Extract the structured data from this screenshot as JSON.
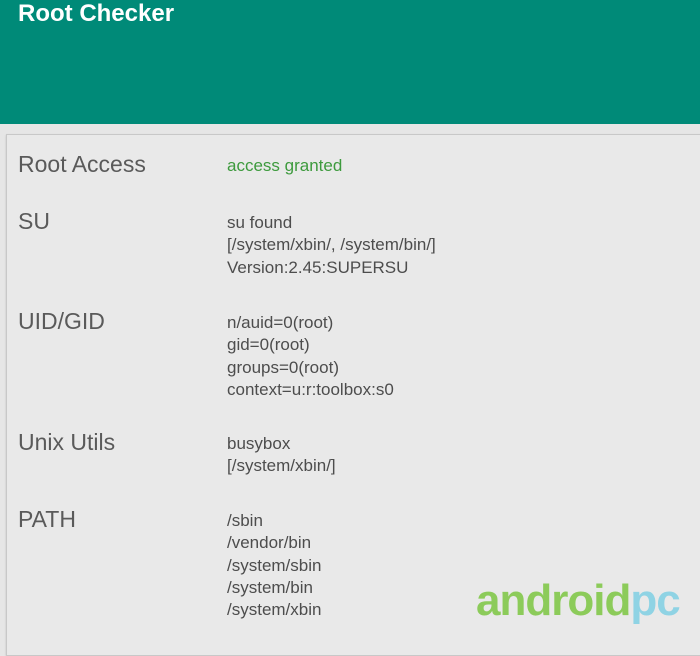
{
  "app": {
    "title": "Root Checker"
  },
  "rows": [
    {
      "label": "Root Access",
      "values": [
        "access granted"
      ]
    },
    {
      "label": "SU",
      "values": [
        "su found",
        "[/system/xbin/, /system/bin/]",
        "Version:2.45:SUPERSU"
      ]
    },
    {
      "label": "UID/GID",
      "values": [
        "n/auid=0(root)",
        "gid=0(root)",
        "groups=0(root)",
        "context=u:r:toolbox:s0"
      ]
    },
    {
      "label": "Unix Utils",
      "values": [
        "busybox",
        "[/system/xbin/]"
      ]
    },
    {
      "label": "PATH",
      "values": [
        "/sbin",
        "/vendor/bin",
        "/system/sbin",
        "/system/bin",
        "/system/xbin"
      ]
    }
  ],
  "watermark": {
    "part1": "android",
    "part2": "pc"
  },
  "colors": {
    "appbar": "#008a78",
    "granted": "#3d9a3d",
    "watermark_green": "#8ccb5a",
    "watermark_blue": "#8fd3e4"
  }
}
